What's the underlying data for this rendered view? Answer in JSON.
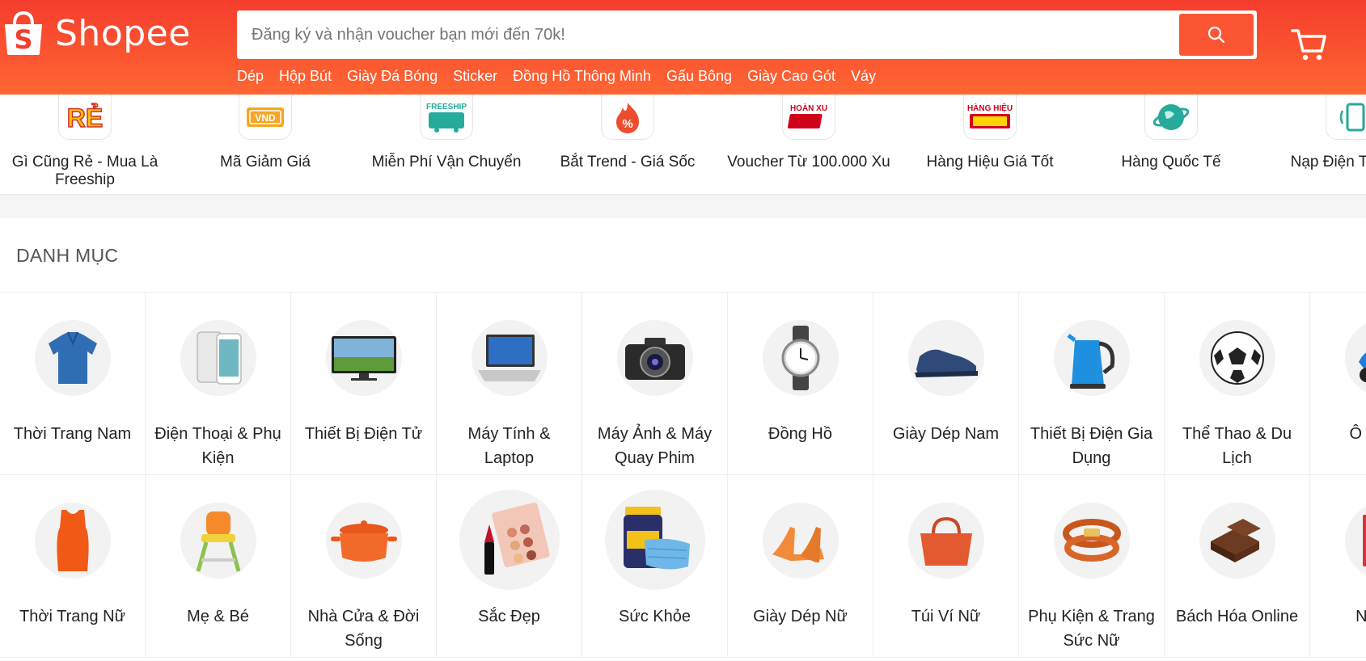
{
  "header": {
    "logo_text": "Shopee",
    "search_placeholder": "Đăng ký và nhận voucher bạn mới đến 70k!",
    "hints": [
      "Dép",
      "Hộp Bút",
      "Giày Đá Bóng",
      "Sticker",
      "Đồng Hồ Thông Minh",
      "Gấu Bông",
      "Giày Cao Gót",
      "Váy"
    ],
    "brand_color": "#ee4d2d"
  },
  "quick_links": [
    {
      "label": "Gì Cũng Rẻ - Mua Là Freeship",
      "icon": "re-badge-icon",
      "badge": "RẺ"
    },
    {
      "label": "Mã Giảm Giá",
      "icon": "voucher-vnd-icon",
      "badge": "VND"
    },
    {
      "label": "Miễn Phí Vận Chuyển",
      "icon": "freeship-xtra-icon",
      "badge": "FREESHIP"
    },
    {
      "label": "Bắt Trend - Giá Sốc",
      "icon": "flame-percent-icon",
      "badge": "%"
    },
    {
      "label": "Voucher Từ 100.000 Xu",
      "icon": "hoan-xu-xtra-icon",
      "badge": "HOÀN XU"
    },
    {
      "label": "Hàng Hiệu Giá Tốt",
      "icon": "hang-hieu-gia-tot-icon",
      "badge": "HÀNG HIỆU"
    },
    {
      "label": "Hàng Quốc Tế",
      "icon": "globe-icon",
      "badge": ""
    },
    {
      "label": "Nạp Điện Th Gam",
      "icon": "phone-topup-icon",
      "badge": ""
    }
  ],
  "categories": {
    "title": "DANH MỤC",
    "items": [
      {
        "label": "Thời Trang Nam",
        "icon": "polo-shirt-icon"
      },
      {
        "label": "Điện Thoại & Phụ Kiện",
        "icon": "smartphone-icon"
      },
      {
        "label": "Thiết Bị Điện Tử",
        "icon": "television-icon"
      },
      {
        "label": "Máy Tính & Laptop",
        "icon": "laptop-icon"
      },
      {
        "label": "Máy Ảnh & Máy Quay Phim",
        "icon": "camera-icon"
      },
      {
        "label": "Đồng Hồ",
        "icon": "wristwatch-icon"
      },
      {
        "label": "Giày Dép Nam",
        "icon": "mens-shoe-icon"
      },
      {
        "label": "Thiết Bị Điện Gia Dụng",
        "icon": "kettle-icon"
      },
      {
        "label": "Thể Thao & Du Lịch",
        "icon": "soccer-ball-icon"
      },
      {
        "label": "Ô Tô & X",
        "icon": "scooter-icon"
      },
      {
        "label": "Thời Trang Nữ",
        "icon": "womens-top-icon"
      },
      {
        "label": "Mẹ & Bé",
        "icon": "high-chair-icon"
      },
      {
        "label": "Nhà Cửa & Đời Sống",
        "icon": "cooking-pot-icon"
      },
      {
        "label": "Sắc Đẹp",
        "icon": "makeup-palette-icon"
      },
      {
        "label": "Sức Khỏe",
        "icon": "vitamins-mask-icon"
      },
      {
        "label": "Giày Dép Nữ",
        "icon": "high-heels-icon"
      },
      {
        "label": "Túi Ví Nữ",
        "icon": "handbag-icon"
      },
      {
        "label": "Phụ Kiện & Trang Sức Nữ",
        "icon": "bracelet-icon"
      },
      {
        "label": "Bách Hóa Online",
        "icon": "chocolate-icon"
      },
      {
        "label": "Nhà Sá",
        "icon": "book-icon"
      }
    ]
  }
}
